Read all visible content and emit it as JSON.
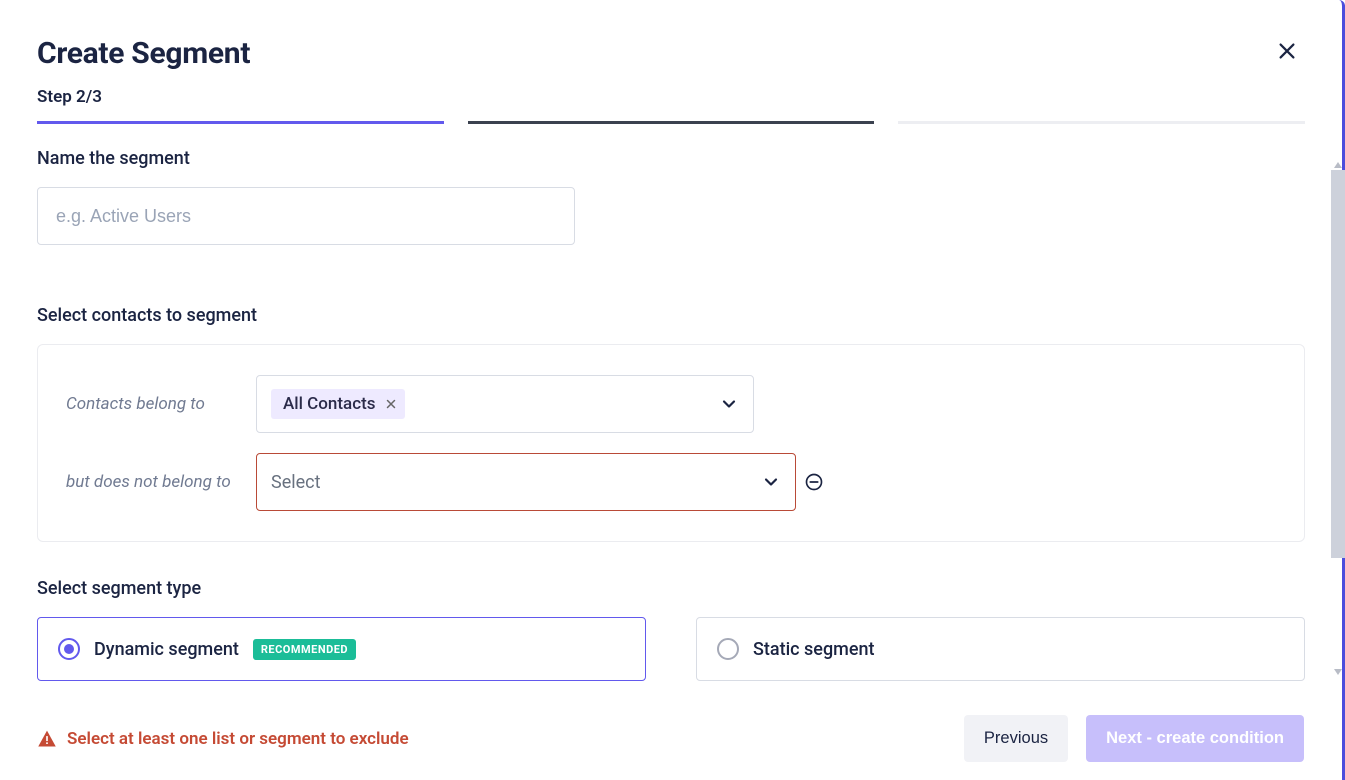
{
  "header": {
    "title": "Create Segment"
  },
  "progress": {
    "step_label": "Step 2/3"
  },
  "sections": {
    "name_label": "Name the segment",
    "name_placeholder": "e.g. Active Users",
    "contacts_label": "Select contacts to segment",
    "type_label": "Select segment type"
  },
  "include": {
    "row_label": "Contacts belong to",
    "chip": "All Contacts"
  },
  "exclude": {
    "row_label": "but does not belong to",
    "placeholder": "Select"
  },
  "segment_types": {
    "dynamic": {
      "label": "Dynamic segment",
      "badge": "RECOMMENDED"
    },
    "static": {
      "label": "Static segment"
    }
  },
  "footer": {
    "error": "Select at least one list or segment to exclude",
    "previous": "Previous",
    "next": "Next - create condition"
  },
  "colors": {
    "accent": "#6259ed",
    "error": "#c54a34",
    "badge": "#1bbd98"
  }
}
